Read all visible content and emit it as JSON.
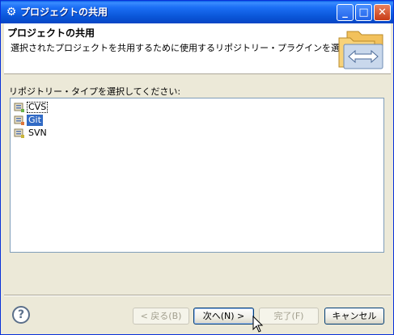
{
  "window": {
    "title": "プロジェクトの共用",
    "icon": "eclipse-gear-icon",
    "controls": [
      "minimize-icon",
      "maximize-icon",
      "close-icon"
    ]
  },
  "banner": {
    "title": "プロジェクトの共用",
    "description": "選択されたプロジェクトを共用するために使用するリポジトリー・プラグインを選択します。",
    "image": "share-folders-icon"
  },
  "main": {
    "section_label": "リポジトリー・タイプを選択してください:",
    "repository_types": [
      {
        "label": "CVS",
        "icon": "cvs-repository-icon",
        "focused": true,
        "selected": false
      },
      {
        "label": "Git",
        "icon": "git-repository-icon",
        "focused": false,
        "selected": true
      },
      {
        "label": "SVN",
        "icon": "svn-repository-icon",
        "focused": false,
        "selected": false
      }
    ]
  },
  "footer": {
    "help_label": "?",
    "back_label": "< 戻る(B)",
    "next_label": "次へ(N) >",
    "finish_label": "完了(F)",
    "cancel_label": "キャンセル"
  },
  "colors": {
    "selection": "#316ac5",
    "titlebar": "#0a56d8",
    "dialog_bg": "#ece9d8"
  }
}
